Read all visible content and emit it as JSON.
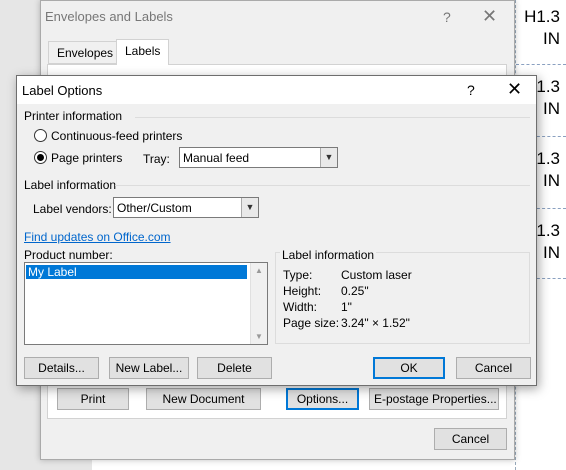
{
  "document": {
    "cells": [
      {
        "line1": "H1.3",
        "line2": "IN"
      },
      {
        "line1": "1.3",
        "line2": "IN"
      },
      {
        "line1": "1.3",
        "line2": "IN"
      },
      {
        "line1": "1.3",
        "line2": "IN"
      }
    ]
  },
  "envelopes_dialog": {
    "title": "Envelopes and Labels",
    "help": "?",
    "close": "✕",
    "tabs": {
      "envelopes": "Envelopes",
      "labels": "Labels"
    },
    "buttons": {
      "print": "Print",
      "new_document": "New Document",
      "options": "Options...",
      "epostage": "E-postage Properties...",
      "cancel": "Cancel"
    }
  },
  "label_options": {
    "title": "Label Options",
    "help": "?",
    "close": "✕",
    "printer_info_heading": "Printer information",
    "continuous_feed": "Continuous-feed printers",
    "page_printers": "Page printers",
    "tray_label": "Tray:",
    "tray_value": "Manual feed",
    "label_info_heading": "Label information",
    "label_vendors_label": "Label vendors:",
    "label_vendors_value": "Other/Custom",
    "find_updates_link": "Find updates on Office.com",
    "product_number_label": "Product number:",
    "product_items": [
      "My Label"
    ],
    "label_info_box": {
      "heading": "Label information",
      "type_label": "Type:",
      "type_value": "Custom laser",
      "height_label": "Height:",
      "height_value": "0.25\"",
      "width_label": "Width:",
      "width_value": "1\"",
      "page_size_label": "Page size:",
      "page_size_value": "3.24\" × 1.52\""
    },
    "buttons": {
      "details": "Details...",
      "new_label": "New Label...",
      "delete": "Delete",
      "ok": "OK",
      "cancel": "Cancel"
    }
  }
}
